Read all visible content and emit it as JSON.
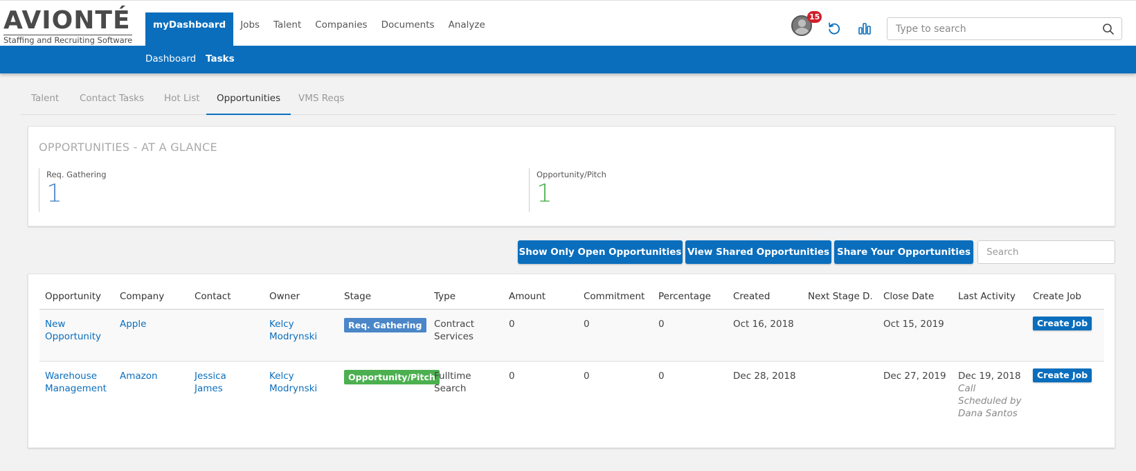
{
  "brand": {
    "name": "AVIONTÉ",
    "tagline": "Staffing and Recruiting Software"
  },
  "main_nav": [
    {
      "label": "myDashboard",
      "active": true
    },
    {
      "label": "Jobs"
    },
    {
      "label": "Talent"
    },
    {
      "label": "Companies"
    },
    {
      "label": "Documents"
    },
    {
      "label": "Analyze"
    }
  ],
  "header": {
    "notification_count": "15",
    "search_placeholder": "Type to search"
  },
  "sub_nav": [
    {
      "label": "Dashboard"
    },
    {
      "label": "Tasks",
      "active": true
    }
  ],
  "tabs": [
    {
      "label": "Talent"
    },
    {
      "label": "Contact Tasks"
    },
    {
      "label": "Hot List"
    },
    {
      "label": "Opportunities",
      "active": true
    },
    {
      "label": "VMS Reqs"
    }
  ],
  "glance": {
    "title": "OPPORTUNITIES - AT A GLANCE",
    "metrics": [
      {
        "label": "Req. Gathering",
        "value": "1",
        "color": "#4a86c8"
      },
      {
        "label": "Opportunity/Pitch",
        "value": "1",
        "color": "#4cb050"
      }
    ]
  },
  "actions": {
    "show_open": "Show Only Open Opportunities",
    "view_shared": "View Shared Opportunities",
    "share_yours": "Share Your Opportunities",
    "search_placeholder": "Search"
  },
  "table": {
    "columns": [
      "Opportunity",
      "Company",
      "Contact",
      "Owner",
      "Stage",
      "Type",
      "Amount",
      "Commitment",
      "Percentage",
      "Created",
      "Next Stage D...",
      "Close Date",
      "Last Activity",
      "Create Job"
    ],
    "rows": [
      {
        "opportunity": "New Opportunity",
        "company": "Apple",
        "contact": "",
        "owner": "Kelcy Modrynski",
        "stage": "Req. Gathering",
        "type": "Contract Services",
        "amount": "0",
        "commitment": "0",
        "percentage": "0",
        "created": "Oct 16, 2018",
        "next_stage": "",
        "close_date": "Oct 15, 2019",
        "last_activity": "",
        "activity_note": "",
        "create_job": "Create Job"
      },
      {
        "opportunity": "Warehouse Management",
        "company": "Amazon",
        "contact": "Jessica James",
        "owner": "Kelcy Modrynski",
        "stage": "Opportunity/Pitch",
        "type": "Fulltime Search",
        "amount": "0",
        "commitment": "0",
        "percentage": "0",
        "created": "Dec 28, 2018",
        "next_stage": "",
        "close_date": "Dec 27, 2019",
        "last_activity": "Dec 19, 2018",
        "activity_note": "Call Scheduled by Dana Santos",
        "create_job": "Create Job"
      }
    ]
  },
  "colors": {
    "primary": "#0a6ebd",
    "req_gathering": "#4a86c8",
    "opportunity_pitch": "#4cb050",
    "badge": "#d0202a"
  }
}
